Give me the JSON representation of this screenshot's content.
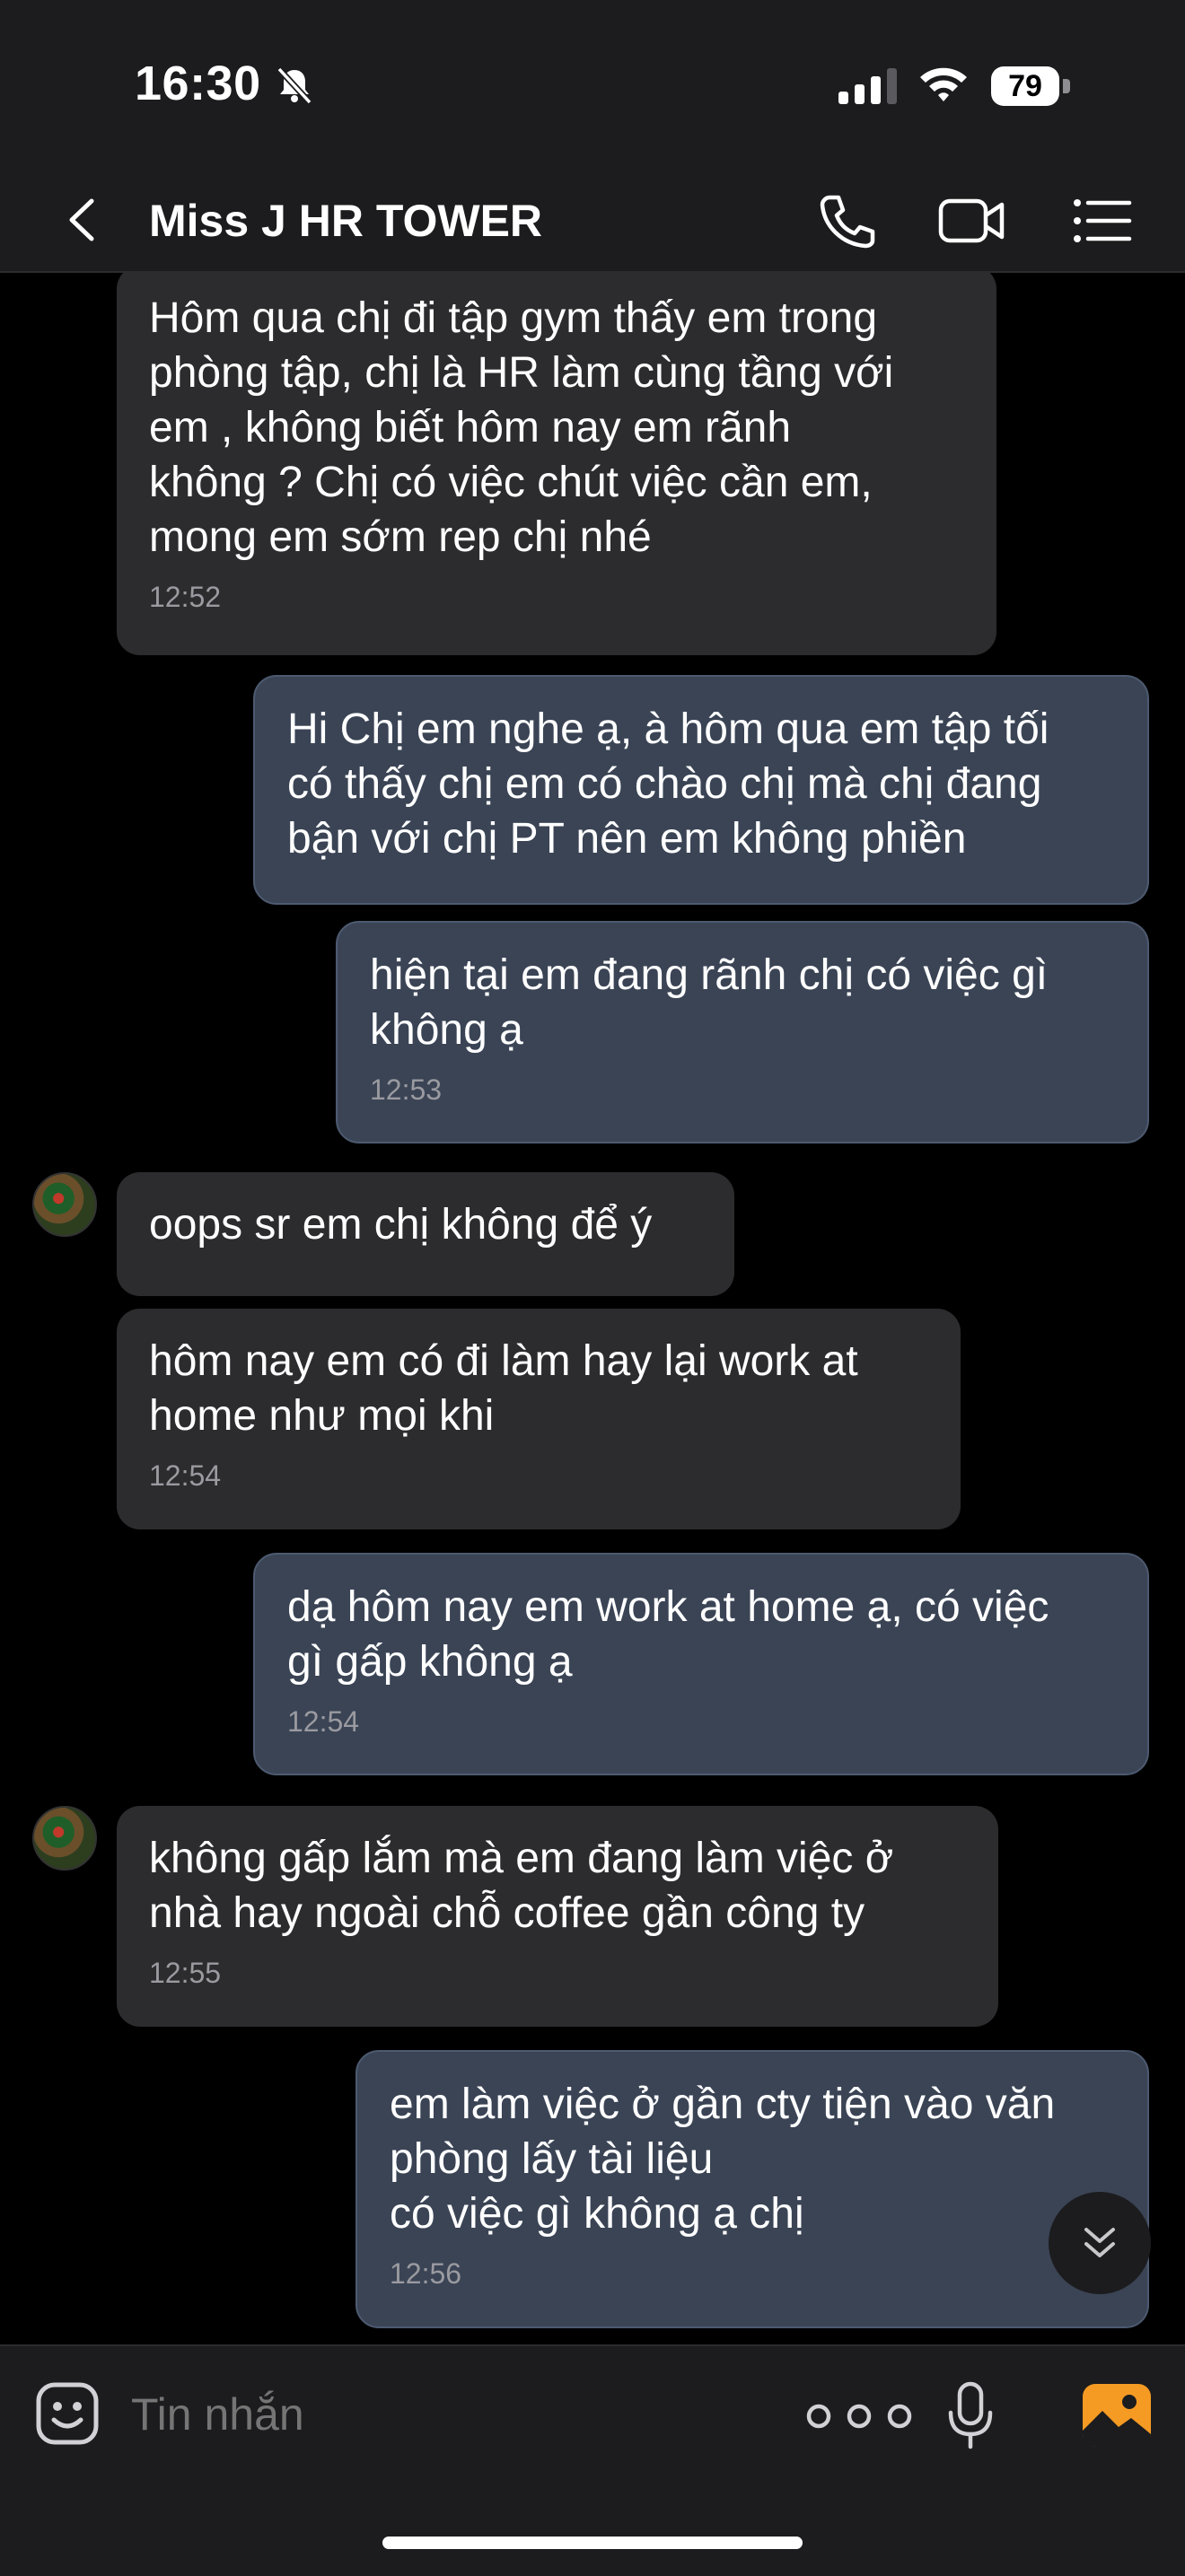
{
  "status_bar": {
    "time": "16:30",
    "battery": "79",
    "icons": [
      "bell-slash-icon",
      "signal-icon",
      "wifi-icon",
      "battery-icon"
    ]
  },
  "header": {
    "title": "Miss J HR TOWER",
    "icons": [
      "back-icon",
      "phone-icon",
      "video-call-icon",
      "menu-list-icon"
    ]
  },
  "messages": [
    {
      "side": "in",
      "text": "Hôm qua chị đi tập gym thấy em trong\nphòng tập, chị là HR làm cùng tầng với\nem , không biết hôm nay em rãnh\nkhông ? Chị có việc chút việc cần em,\nmong em sớm rep chị nhé",
      "time": "12:52"
    },
    {
      "side": "out",
      "text": "Hi Chị em nghe ạ, à hôm qua em tập tối\ncó thấy chị em có chào chị mà chị đang\nbận với chị PT nên em không phiền",
      "time": ""
    },
    {
      "side": "out",
      "text": "hiện tại em đang rãnh chị có việc gì\nkhông ạ",
      "time": "12:53"
    },
    {
      "side": "in",
      "text": "oops sr em chị không để ý",
      "time": ""
    },
    {
      "side": "in",
      "text": "hôm nay em có đi làm hay lại work at\nhome như mọi khi",
      "time": "12:54"
    },
    {
      "side": "out",
      "text": "dạ hôm nay em work at home ạ, có việc\ngì gấp không ạ",
      "time": "12:54"
    },
    {
      "side": "in",
      "text": "không gấp lắm mà em đang làm việc ở\nnhà hay ngoài chỗ coffee gần công ty",
      "time": "12:55"
    },
    {
      "side": "out",
      "text": "em làm việc ở gần cty tiện vào văn\nphòng lấy tài liệu\ncó việc gì không ạ chị",
      "time": "12:56"
    }
  ],
  "input_bar": {
    "placeholder": "Tin nhắn",
    "icons": [
      "emoji-icon",
      "more-icon",
      "microphone-icon",
      "gallery-icon"
    ]
  },
  "colors": {
    "background": "#000000",
    "incoming_bubble": "#2c2c2e",
    "outgoing_bubble": "#3a4455",
    "gallery_accent": "#f59a23"
  }
}
